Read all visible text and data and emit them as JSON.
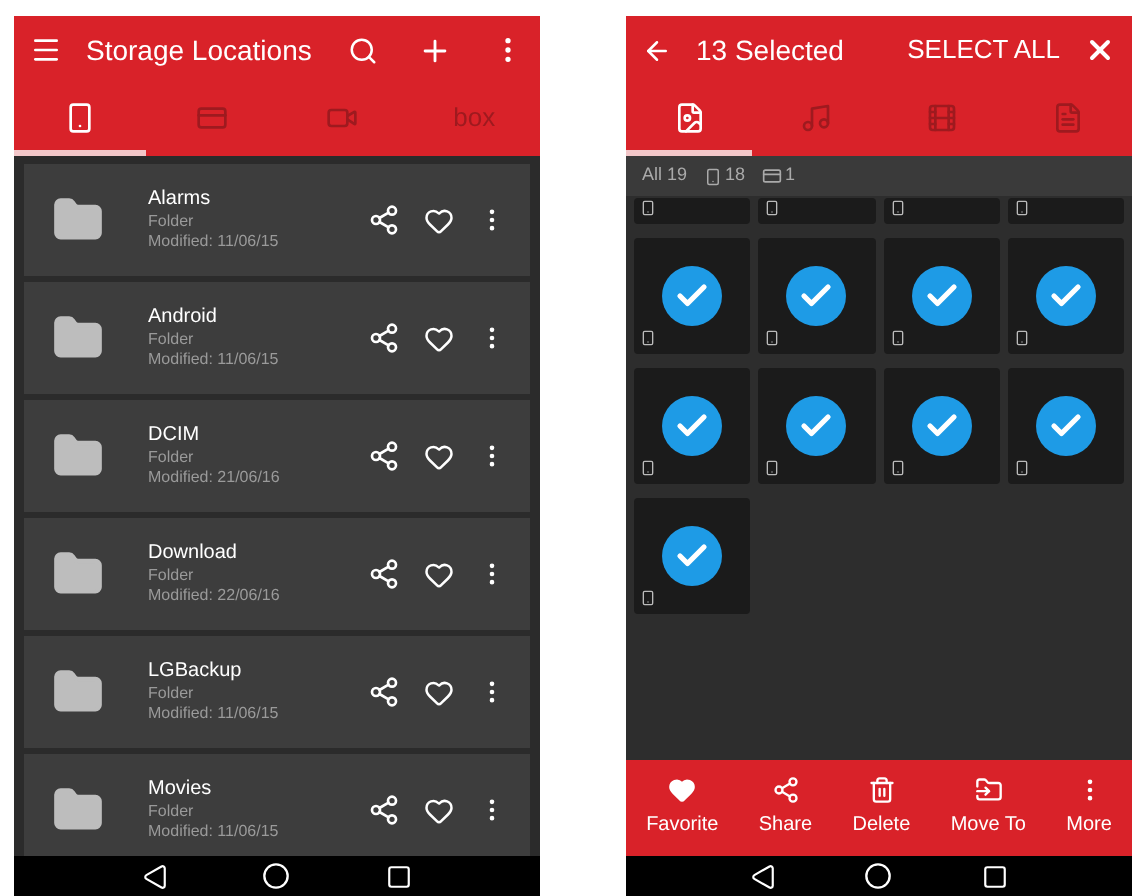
{
  "left_screen": {
    "title": "Storage Locations",
    "tabs": [
      {
        "kind": "phone",
        "selected": true
      },
      {
        "kind": "card",
        "selected": false
      },
      {
        "kind": "camera",
        "selected": false
      },
      {
        "kind": "text",
        "label": "box",
        "selected": false
      }
    ],
    "folders": [
      {
        "name": "Alarms",
        "type": "Folder",
        "modified": "Modified: 11/06/15"
      },
      {
        "name": "Android",
        "type": "Folder",
        "modified": "Modified: 11/06/15"
      },
      {
        "name": "DCIM",
        "type": "Folder",
        "modified": "Modified: 21/06/16"
      },
      {
        "name": "Download",
        "type": "Folder",
        "modified": "Modified: 22/06/16"
      },
      {
        "name": "LGBackup",
        "type": "Folder",
        "modified": "Modified: 11/06/15"
      },
      {
        "name": "Movies",
        "type": "Folder",
        "modified": "Modified: 11/06/15"
      }
    ]
  },
  "right_screen": {
    "title": "13 Selected",
    "select_all": "SELECT ALL",
    "tabs": [
      {
        "kind": "image",
        "selected": true
      },
      {
        "kind": "music",
        "selected": false
      },
      {
        "kind": "video",
        "selected": false
      },
      {
        "kind": "document",
        "selected": false
      }
    ],
    "filters": [
      {
        "kind": "all",
        "label": "All 19"
      },
      {
        "kind": "phone",
        "label": "18"
      },
      {
        "kind": "card",
        "label": "1"
      }
    ],
    "tiles": [
      {
        "kind": "partial"
      },
      {
        "kind": "partial"
      },
      {
        "kind": "partial"
      },
      {
        "kind": "partial"
      },
      {
        "kind": "full",
        "selected": true
      },
      {
        "kind": "full",
        "selected": true
      },
      {
        "kind": "full",
        "selected": true
      },
      {
        "kind": "full",
        "selected": true
      },
      {
        "kind": "full",
        "selected": true
      },
      {
        "kind": "full",
        "selected": true
      },
      {
        "kind": "full",
        "selected": true
      },
      {
        "kind": "full",
        "selected": true
      },
      {
        "kind": "full",
        "selected": true
      }
    ],
    "actions": [
      {
        "kind": "heart",
        "label": "Favorite"
      },
      {
        "kind": "share",
        "label": "Share"
      },
      {
        "kind": "trash",
        "label": "Delete"
      },
      {
        "kind": "move",
        "label": "Move To"
      },
      {
        "kind": "more",
        "label": "More"
      }
    ]
  }
}
